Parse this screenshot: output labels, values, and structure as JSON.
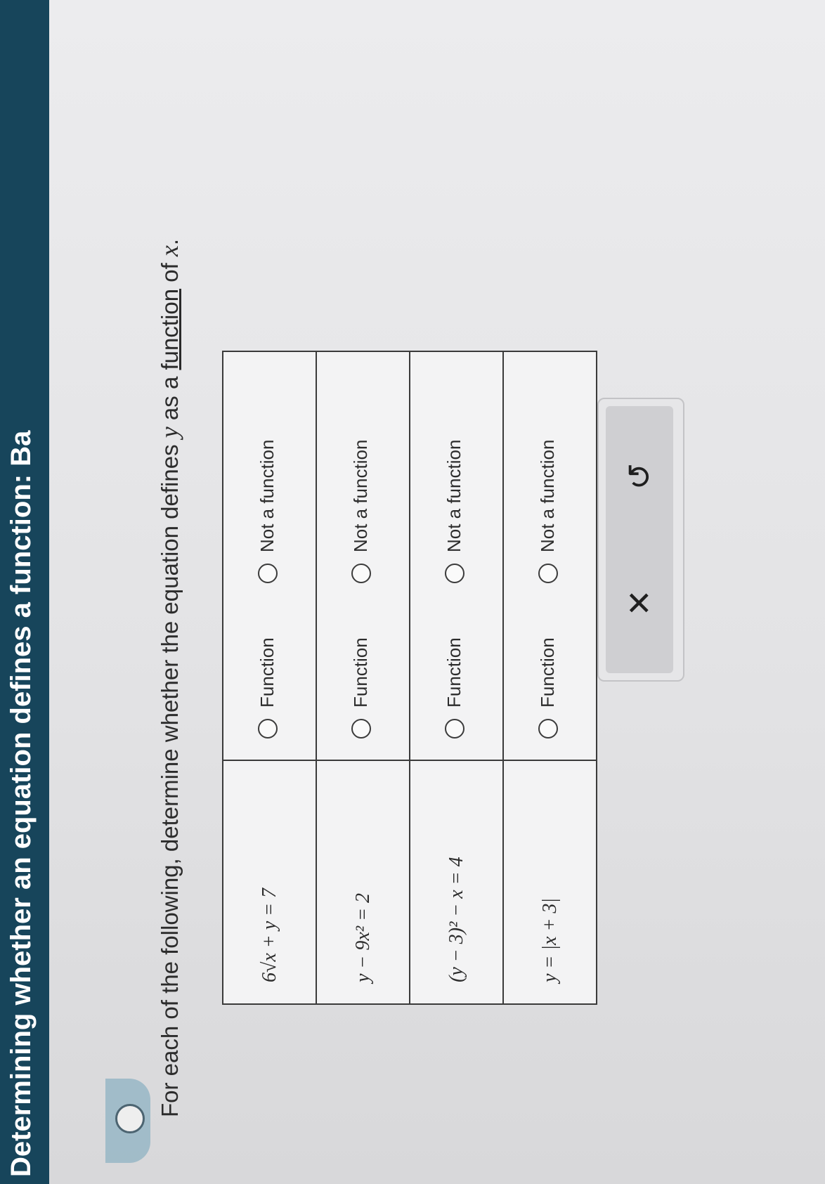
{
  "header": {
    "title": "Determining whether an equation defines a function: Ba"
  },
  "prompt": {
    "lead": "For each of the following, determine whether the equation defines ",
    "var_y": "y",
    "mid": " as a ",
    "link": "function",
    "tail_pre": " of ",
    "var_x": "x",
    "end": "."
  },
  "rows": [
    {
      "equation": "6√x + y = 7",
      "option_a": "Function",
      "option_b": "Not a function"
    },
    {
      "equation": "y − 9x² = 2",
      "option_a": "Function",
      "option_b": "Not a function"
    },
    {
      "equation": "(y − 3)² − x = 4",
      "option_a": "Function",
      "option_b": "Not a function"
    },
    {
      "equation": "y = |x + 3|",
      "option_a": "Function",
      "option_b": "Not a function"
    }
  ],
  "actions": {
    "clear_icon": "✕",
    "undo_icon": "↺",
    "clear_icon_name": "close-icon",
    "undo_icon_name": "undo-icon"
  }
}
